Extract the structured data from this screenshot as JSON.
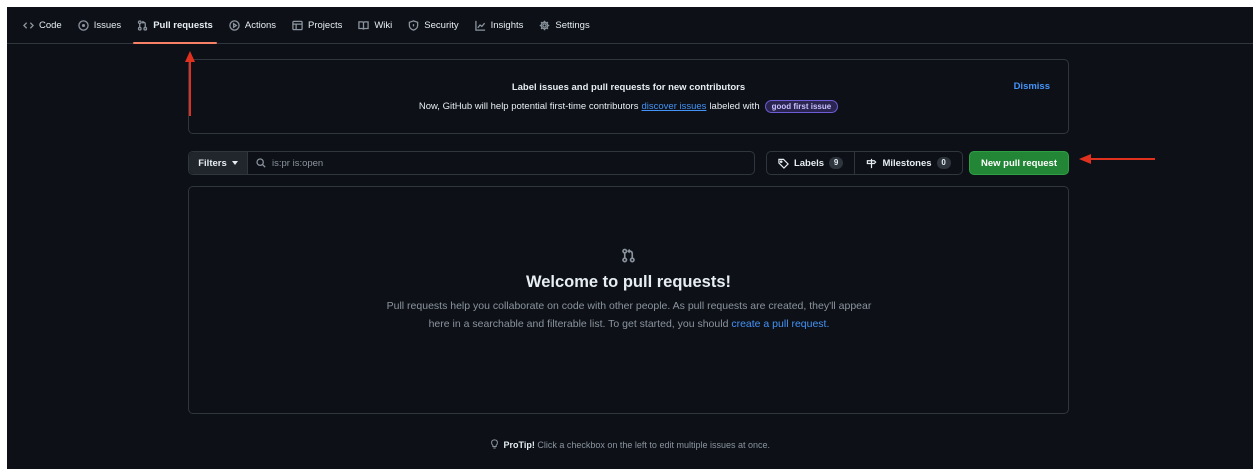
{
  "nav": {
    "items": [
      {
        "label": "Code",
        "icon": "code-icon"
      },
      {
        "label": "Issues",
        "icon": "issue-opened-icon"
      },
      {
        "label": "Pull requests",
        "icon": "git-pull-request-icon",
        "selected": true
      },
      {
        "label": "Actions",
        "icon": "play-icon"
      },
      {
        "label": "Projects",
        "icon": "table-icon"
      },
      {
        "label": "Wiki",
        "icon": "book-icon"
      },
      {
        "label": "Security",
        "icon": "shield-icon"
      },
      {
        "label": "Insights",
        "icon": "graph-icon"
      },
      {
        "label": "Settings",
        "icon": "gear-icon"
      }
    ]
  },
  "banner": {
    "title": "Label issues and pull requests for new contributors",
    "text_before": "Now, GitHub will help potential first-time contributors",
    "link": "discover issues",
    "text_after": "labeled with",
    "label": "good first issue",
    "dismiss": "Dismiss"
  },
  "toolbar": {
    "filters_label": "Filters",
    "search_value": "is:pr is:open",
    "labels_label": "Labels",
    "labels_count": "9",
    "milestones_label": "Milestones",
    "milestones_count": "0",
    "new_pr_label": "New pull request"
  },
  "blankslate": {
    "title": "Welcome to pull requests!",
    "body": "Pull requests help you collaborate on code with other people. As pull requests are created, they'll appear here in a searchable and filterable list. To get started, you should",
    "link": "create a pull request",
    "end": "."
  },
  "protip": {
    "label": "ProTip!",
    "text": "Click a checkbox on the left to edit multiple issues at once."
  },
  "colors": {
    "background": "#0d1117",
    "border": "#30363d",
    "accent_blue": "#4493f8",
    "primary_green": "#238636",
    "selected_underline": "#f78166",
    "annotation_arrow": "#e0301e"
  }
}
